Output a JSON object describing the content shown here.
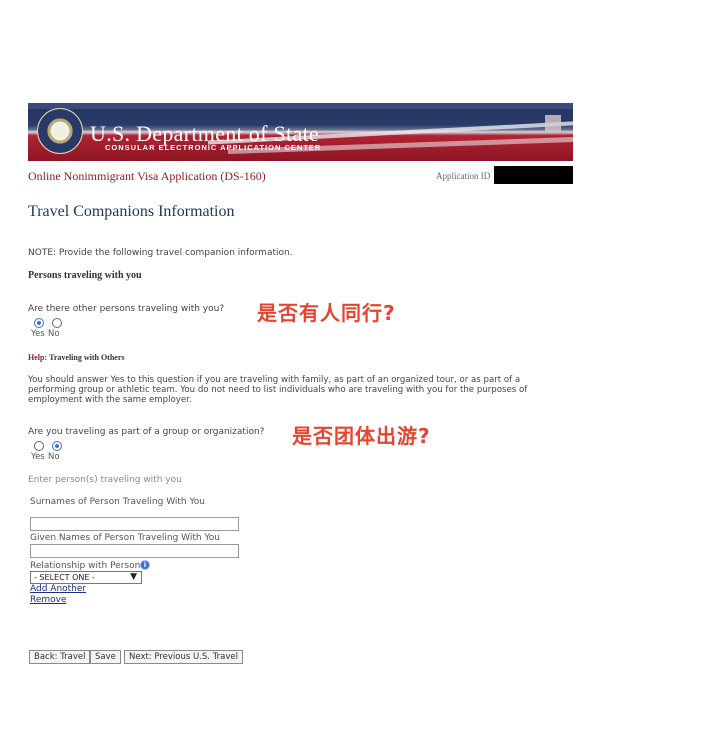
{
  "banner": {
    "title": "U.S. Department of State",
    "subtitle": "CONSULAR ELECTRONIC APPLICATION CENTER"
  },
  "app_bar": {
    "app_title": "Online Nonimmigrant Visa Application (DS-160)",
    "app_id_label": "Application ID"
  },
  "page_title": "Travel Companions Information",
  "note": "NOTE: Provide the following travel companion information.",
  "section_heading": "Persons traveling with you",
  "question1": {
    "text": "Are there other persons traveling with you?",
    "annotation": "是否有人同行?",
    "yes_label": "Yes",
    "no_label": "No",
    "selected": "Yes"
  },
  "help": {
    "label": "Help:",
    "title": "Traveling with Others",
    "text": "You should answer Yes to this question if you are traveling with family, as part of an organized tour, or as part of a performing group or athletic team. You do not need to list individuals who are traveling with you for the purposes of employment with the same employer."
  },
  "question2": {
    "text": "Are you traveling as part of a group or organization?",
    "annotation": "是否团体出游?",
    "yes_label": "Yes",
    "no_label": "No",
    "selected": "No"
  },
  "companion_form": {
    "heading": "Enter person(s) traveling with you",
    "surname_label": "Surnames of Person Traveling With You",
    "surname_value": "",
    "given_label": "Given Names of Person Traveling With You",
    "given_value": "",
    "relationship_label": "Relationship with Person",
    "relationship_selected": "- SELECT ONE -",
    "add_link": "Add Another",
    "remove_link": "Remove"
  },
  "buttons": {
    "back": "Back: Travel",
    "save": "Save",
    "next": "Next: Previous U.S. Travel"
  },
  "colors": {
    "title_red": "#8b1e24",
    "heading_blue": "#1f3557",
    "annotation_red": "#e8432e",
    "radio_blue": "#3a6fd8"
  }
}
